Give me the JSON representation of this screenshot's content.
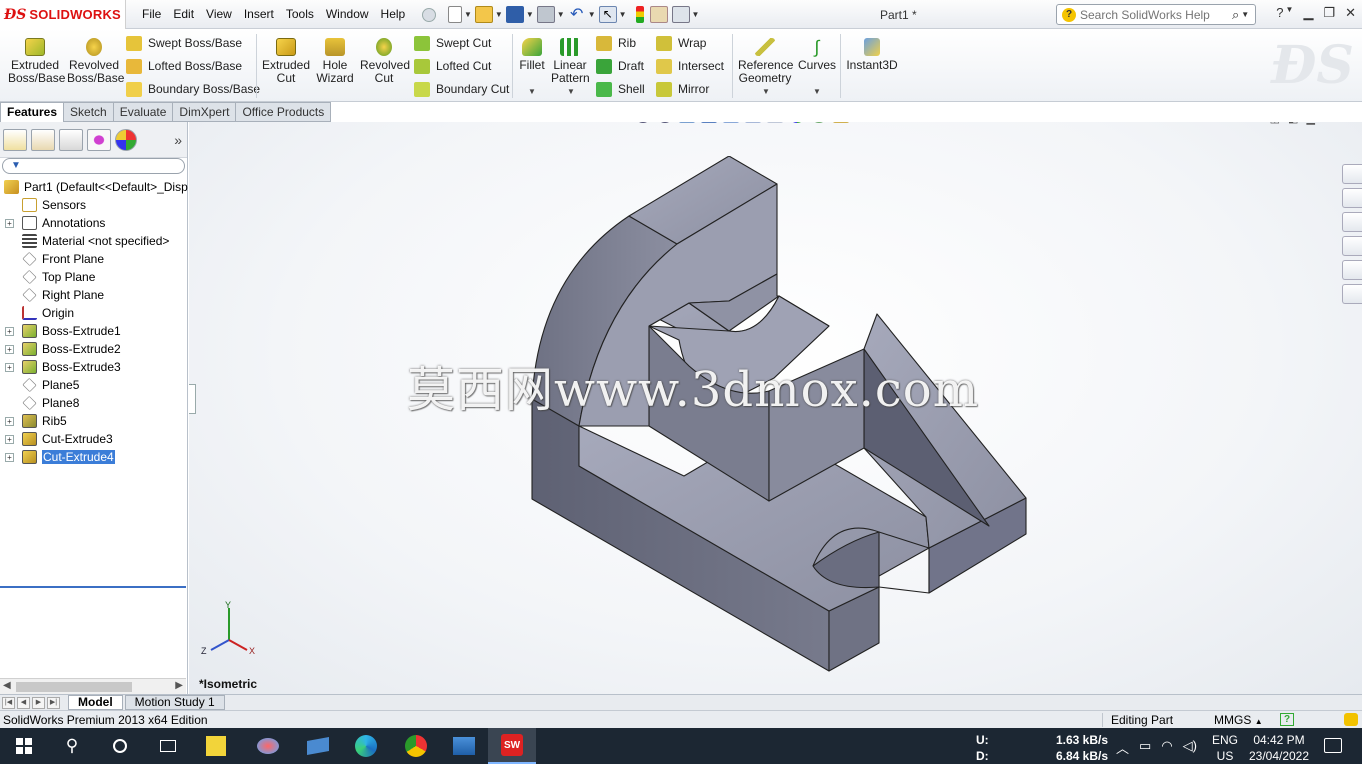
{
  "app": {
    "logo_text": "SOLIDWORKS",
    "document_title": "Part1 *",
    "menus": [
      "File",
      "Edit",
      "View",
      "Insert",
      "Tools",
      "Window",
      "Help"
    ],
    "search_placeholder": "Search SolidWorks Help"
  },
  "ribbon": {
    "extruded_boss": [
      "Extruded",
      "Boss/Base"
    ],
    "revolved_boss": [
      "Revolved",
      "Boss/Base"
    ],
    "swept_boss": "Swept Boss/Base",
    "lofted_boss": "Lofted Boss/Base",
    "boundary_boss": "Boundary Boss/Base",
    "extruded_cut": [
      "Extruded",
      "Cut"
    ],
    "hole_wizard": [
      "Hole",
      "Wizard"
    ],
    "revolved_cut": [
      "Revolved",
      "Cut"
    ],
    "swept_cut": "Swept Cut",
    "lofted_cut": "Lofted Cut",
    "boundary_cut": "Boundary Cut",
    "fillet": "Fillet",
    "linear_pattern": [
      "Linear",
      "Pattern"
    ],
    "rib": "Rib",
    "draft": "Draft",
    "shell": "Shell",
    "wrap": "Wrap",
    "intersect": "Intersect",
    "mirror": "Mirror",
    "reference_geometry": [
      "Reference",
      "Geometry"
    ],
    "curves": "Curves",
    "instant3d": "Instant3D"
  },
  "command_tabs": [
    "Features",
    "Sketch",
    "Evaluate",
    "DimXpert",
    "Office Products"
  ],
  "feature_tree": {
    "root": "Part1  (Default<<Default>_Disp",
    "items": [
      {
        "label": "Sensors",
        "icon": "sensors-icon",
        "expandable": false
      },
      {
        "label": "Annotations",
        "icon": "annotations-icon",
        "expandable": true
      },
      {
        "label": "Material <not specified>",
        "icon": "material-icon",
        "expandable": false
      },
      {
        "label": "Front Plane",
        "icon": "plane-icon",
        "expandable": false
      },
      {
        "label": "Top Plane",
        "icon": "plane-icon",
        "expandable": false
      },
      {
        "label": "Right Plane",
        "icon": "plane-icon",
        "expandable": false
      },
      {
        "label": "Origin",
        "icon": "origin-icon",
        "expandable": false
      },
      {
        "label": "Boss-Extrude1",
        "icon": "boss-extrude-icon",
        "expandable": true
      },
      {
        "label": "Boss-Extrude2",
        "icon": "boss-extrude-icon",
        "expandable": true
      },
      {
        "label": "Boss-Extrude3",
        "icon": "boss-extrude-icon",
        "expandable": true
      },
      {
        "label": "Plane5",
        "icon": "plane-icon",
        "expandable": false
      },
      {
        "label": "Plane8",
        "icon": "plane-icon",
        "expandable": false
      },
      {
        "label": "Rib5",
        "icon": "rib-icon",
        "expandable": true
      },
      {
        "label": "Cut-Extrude3",
        "icon": "cut-extrude-icon",
        "expandable": true
      },
      {
        "label": "Cut-Extrude4",
        "icon": "cut-extrude-icon",
        "expandable": true,
        "selected": true
      }
    ]
  },
  "viewport": {
    "watermark": "莫西网www.3dmox.com",
    "view_label": "*Isometric",
    "triad_labels": {
      "y": "Y",
      "z": "Z",
      "x": "X"
    },
    "model_color": "#8a8da0"
  },
  "bottom_tabs": [
    "Model",
    "Motion Study 1"
  ],
  "status": {
    "edition": "SolidWorks Premium 2013 x64 Edition",
    "mode": "Editing Part",
    "units": "MMGS"
  },
  "taskbar": {
    "net_labels": [
      "U:",
      "D:"
    ],
    "net_values": [
      "1.63 kB/s",
      "6.84 kB/s"
    ],
    "lang": [
      "ENG",
      "US"
    ],
    "time": "04:42 PM",
    "date": "23/04/2022"
  }
}
